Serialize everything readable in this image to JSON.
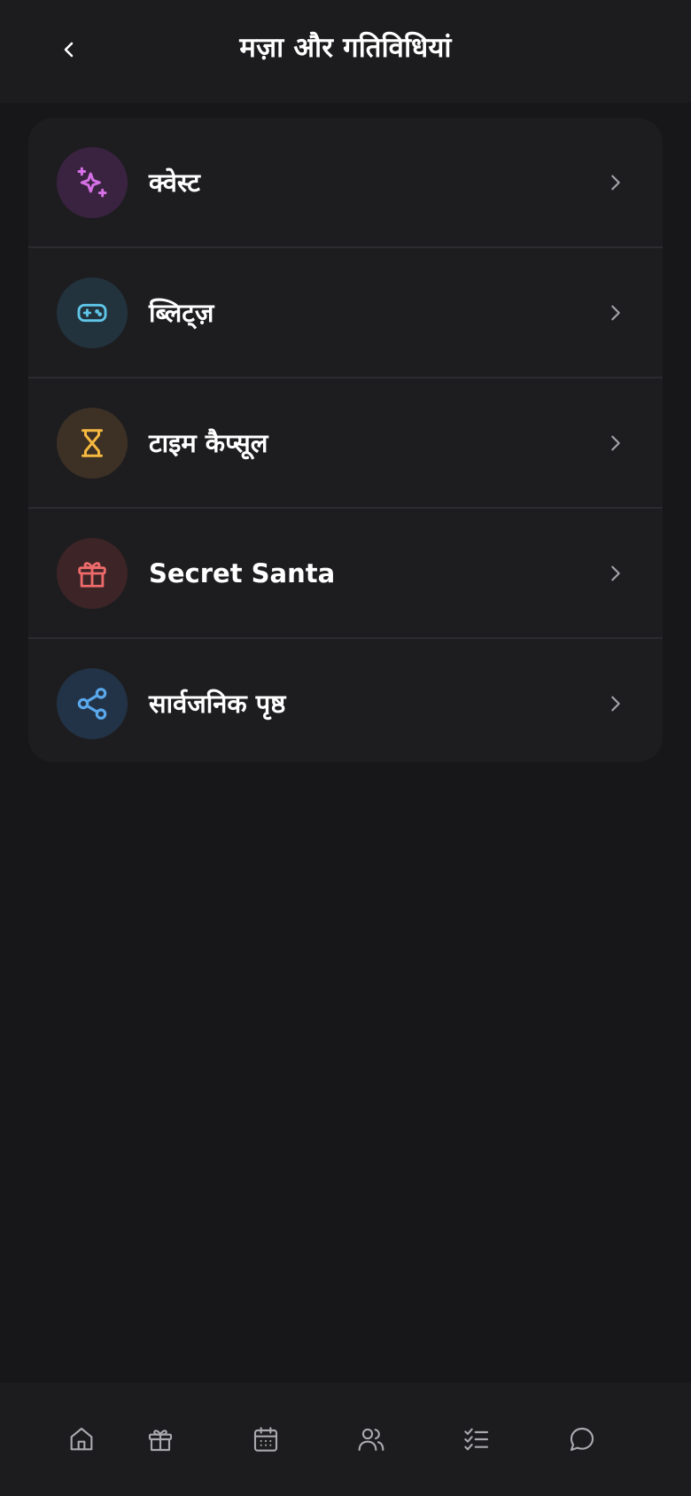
{
  "header": {
    "title": "मज़ा और गतिविधियां",
    "back_icon": "chevron-left-icon"
  },
  "menu": {
    "items": [
      {
        "label": "क्वेस्ट",
        "icon": "sparkles-icon",
        "icon_color": "#d670e6",
        "icon_bg": "#3a2340"
      },
      {
        "label": "ब्लिट्ज़",
        "icon": "gamepad-icon",
        "icon_color": "#5fc6e8",
        "icon_bg": "#22333e"
      },
      {
        "label": "टाइम कैप्सूल",
        "icon": "hourglass-icon",
        "icon_color": "#f5b840",
        "icon_bg": "#3d3024"
      },
      {
        "label": "Secret Santa",
        "icon": "gift-icon",
        "icon_color": "#ef6b6b",
        "icon_bg": "#3d2426"
      },
      {
        "label": "सार्वजनिक पृष्ठ",
        "icon": "share-icon",
        "icon_color": "#5aa8ec",
        "icon_bg": "#233347"
      }
    ]
  },
  "bottom_nav": {
    "items": [
      "home-icon",
      "gift-icon",
      "calendar-icon",
      "users-icon",
      "checklist-icon",
      "chat-icon"
    ]
  },
  "colors": {
    "background": "#171719",
    "card": "#1d1d20",
    "divider": "#2c2c30",
    "nav_icon": "#a9a9ae",
    "chevron": "#a1a1a6"
  }
}
